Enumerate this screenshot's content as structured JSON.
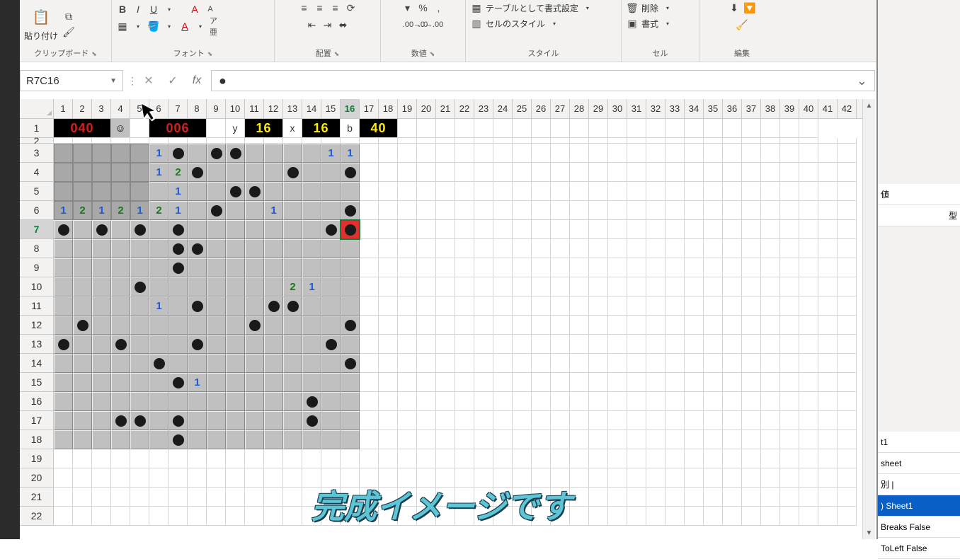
{
  "ribbon": {
    "clipboard": {
      "paste": "貼り付け",
      "title": "クリップボード"
    },
    "font": {
      "title": "フォント"
    },
    "alignment": {
      "title": "配置"
    },
    "number": {
      "title": "数値"
    },
    "styles": {
      "table_format": "テーブルとして書式設定",
      "cell_styles": "セルのスタイル",
      "title": "スタイル"
    },
    "cells": {
      "delete": "削除",
      "format": "書式",
      "title": "セル"
    },
    "editing": {
      "title": "編集"
    }
  },
  "name_box": "R7C16",
  "formula_value": "●",
  "col_headers": [
    "1",
    "2",
    "3",
    "4",
    "5",
    "6",
    "7",
    "8",
    "9",
    "10",
    "11",
    "12",
    "13",
    "14",
    "15",
    "16",
    "17",
    "18",
    "19",
    "20",
    "21",
    "22",
    "23",
    "24",
    "25",
    "26",
    "27",
    "28",
    "29",
    "30",
    "31",
    "32",
    "33",
    "34",
    "35",
    "36",
    "37",
    "38",
    "39",
    "40",
    "41",
    "42"
  ],
  "selected_col": "16",
  "selected_row": "7",
  "row_headers": [
    "1",
    "2",
    "3",
    "4",
    "5",
    "6",
    "7",
    "8",
    "9",
    "10",
    "11",
    "12",
    "13",
    "14",
    "15",
    "16",
    "17",
    "18",
    "19",
    "20",
    "21",
    "22"
  ],
  "game_header": {
    "counter1": "040",
    "counter2": "006",
    "y_label": "y",
    "y_val": "16",
    "x_label": "x",
    "x_val": "16",
    "b_label": "b",
    "b_val": "40",
    "face": "☺"
  },
  "grid": [
    [
      0,
      0,
      0,
      0,
      0,
      "1",
      "M",
      0,
      "M",
      "M",
      0,
      0,
      0,
      0,
      "1",
      "1"
    ],
    [
      0,
      0,
      0,
      0,
      0,
      "1",
      "2",
      "M",
      0,
      0,
      0,
      0,
      "M",
      0,
      0,
      "M"
    ],
    [
      0,
      0,
      0,
      0,
      0,
      0,
      "1",
      0,
      0,
      "M",
      "M",
      0,
      0,
      0,
      0,
      0
    ],
    [
      "1",
      "2",
      "1",
      "2",
      "1",
      "2",
      "1",
      0,
      "M",
      0,
      0,
      "1",
      0,
      0,
      0,
      "M"
    ],
    [
      "M",
      0,
      "M",
      0,
      "M",
      0,
      "M",
      0,
      0,
      0,
      0,
      0,
      0,
      0,
      "M",
      "MR"
    ],
    [
      0,
      0,
      0,
      0,
      0,
      0,
      "M",
      "M",
      0,
      0,
      0,
      0,
      0,
      0,
      0,
      0
    ],
    [
      0,
      0,
      0,
      0,
      0,
      0,
      "M",
      0,
      0,
      0,
      0,
      0,
      0,
      0,
      0,
      0
    ],
    [
      0,
      0,
      0,
      0,
      "M",
      0,
      0,
      0,
      0,
      0,
      0,
      0,
      "2",
      "1",
      0,
      0
    ],
    [
      0,
      0,
      0,
      0,
      0,
      "1",
      0,
      "M",
      0,
      0,
      0,
      "M",
      "M",
      0,
      0,
      0
    ],
    [
      0,
      "M",
      0,
      0,
      0,
      0,
      0,
      0,
      0,
      0,
      "M",
      0,
      0,
      0,
      0,
      "M"
    ],
    [
      "M",
      0,
      0,
      "M",
      0,
      0,
      0,
      "M",
      0,
      0,
      0,
      0,
      0,
      0,
      "M",
      0
    ],
    [
      0,
      0,
      0,
      0,
      0,
      "M",
      0,
      0,
      0,
      0,
      0,
      0,
      0,
      0,
      0,
      "M"
    ],
    [
      0,
      0,
      0,
      0,
      0,
      0,
      "M",
      "1",
      0,
      0,
      0,
      0,
      0,
      0,
      0,
      0
    ],
    [
      0,
      0,
      0,
      0,
      0,
      0,
      0,
      0,
      0,
      0,
      0,
      0,
      0,
      "M",
      0,
      0
    ],
    [
      0,
      0,
      0,
      "M",
      "M",
      0,
      "M",
      0,
      0,
      0,
      0,
      0,
      0,
      "M",
      0,
      0
    ],
    [
      0,
      0,
      0,
      0,
      0,
      0,
      "M",
      0,
      0,
      0,
      0,
      0,
      0,
      0,
      0,
      0
    ]
  ],
  "revealed_area": {
    "rows": [
      0,
      1,
      2,
      3
    ],
    "cols": [
      0,
      1,
      2,
      3,
      4
    ]
  },
  "caption": "完成イメージです",
  "right_panel": {
    "t1": "t1",
    "items": [
      {
        "k": "値",
        "v": ""
      },
      {
        "k": "型",
        "v": ""
      },
      {
        "k": "sheet",
        "v": ""
      },
      {
        "k": "別 |",
        "v": ""
      },
      {
        "k": ")",
        "v": "Sheet1",
        "hl": true
      },
      {
        "k": "Breaks",
        "v": "False"
      },
      {
        "k": "ToLeft",
        "v": "False"
      }
    ]
  }
}
